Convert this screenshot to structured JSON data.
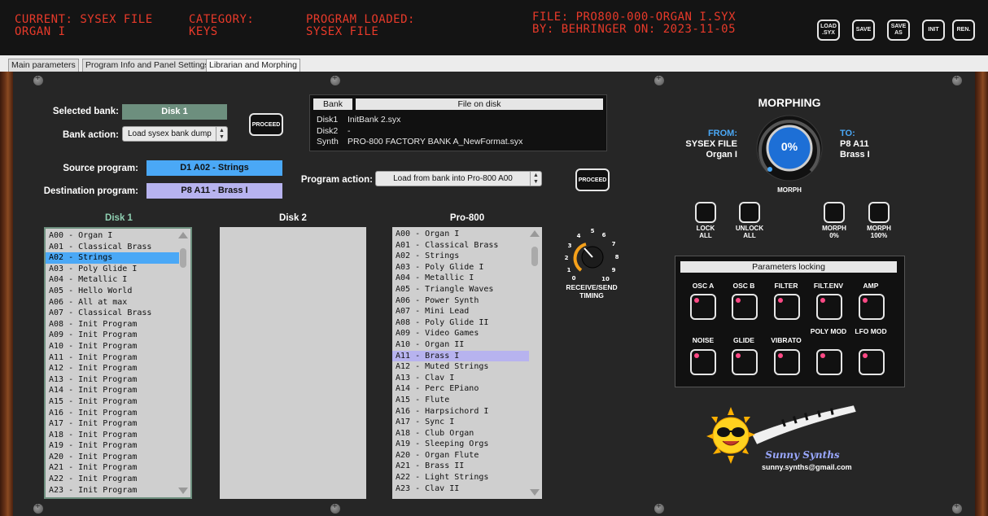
{
  "header": {
    "current_label": "CURRENT: SYSEX FILE",
    "current_value": "ORGAN I",
    "category_label": "CATEGORY:",
    "category_value": "KEYS",
    "loaded_label": "PROGRAM LOADED:",
    "loaded_value": "SYSEX FILE",
    "file_line": "FILE: PRO800-000-ORGAN I.SYX",
    "by_line": "BY: BEHRINGER ON: 2023-11-05",
    "buttons": [
      "LOAD .SYX",
      "SAVE",
      "SAVE AS",
      "INIT",
      "REN."
    ]
  },
  "tabs": [
    "Main parameters",
    "Program Info and Panel Settings",
    "Librarian and Morphing"
  ],
  "librarian": {
    "selected_bank_label": "Selected bank:",
    "selected_bank_value": "Disk 1",
    "bank_action_label": "Bank action:",
    "bank_action_value": "Load sysex bank dump",
    "proceed_label": "PROCEED",
    "source_label": "Source program:",
    "source_value": "D1 A02 - Strings",
    "dest_label": "Destination program:",
    "dest_value": "P8 A11 - Brass I",
    "program_action_label": "Program action:",
    "program_action_value": "Load from bank into Pro-800 A00",
    "file_table": {
      "col_bank": "Bank",
      "col_file": "File on disk",
      "rows": [
        {
          "bank": "Disk1",
          "file": "InitBank 2.syx"
        },
        {
          "bank": "Disk2",
          "file": "-"
        },
        {
          "bank": "Synth",
          "file": "PRO-800 FACTORY BANK A_NewFormat.syx"
        }
      ]
    },
    "disk1_title": "Disk 1",
    "disk2_title": "Disk 2",
    "pro800_title": "Pro-800",
    "disk1_items": [
      "A00 - Organ I",
      "A01 - Classical Brass",
      "A02 - Strings",
      "A03 - Poly Glide I",
      "A04 - Metallic I",
      "A05 - Hello World",
      "A06 - All at max",
      "A07 - Classical Brass",
      "A08 - Init Program",
      "A09 - Init Program",
      "A10 - Init Program",
      "A11 - Init Program",
      "A12 - Init Program",
      "A13 - Init Program",
      "A14 - Init Program",
      "A15 - Init Program",
      "A16 - Init Program",
      "A17 - Init Program",
      "A18 - Init Program",
      "A19 - Init Program",
      "A20 - Init Program",
      "A21 - Init Program",
      "A22 - Init Program",
      "A23 - Init Program"
    ],
    "pro800_items": [
      "A00 - Organ I",
      "A01 - Classical Brass",
      "A02 - Strings",
      "A03 - Poly Glide I",
      "A04 - Metallic I",
      "A05 - Triangle Waves",
      "A06 - Power Synth",
      "A07 - Mini Lead",
      "A08 - Poly Glide II",
      "A09 - Video Games",
      "A10 - Organ II",
      "A11 - Brass I",
      "A12 - Muted Strings",
      "A13 - Clav I",
      "A14 - Perc EPiano",
      "A15 - Flute",
      "A16 - Harpsichord I",
      "A17 - Sync I",
      "A18 - Club Organ",
      "A19 - Sleeping Orgs",
      "A20 - Organ Flute",
      "A21 - Brass II",
      "A22 - Light Strings",
      "A23 - Clav II"
    ],
    "timing_label": "RECEIVE/SEND",
    "timing_label2": "TIMING",
    "timing_scale": [
      "0",
      "1",
      "2",
      "3",
      "4",
      "5",
      "6",
      "7",
      "8",
      "9",
      "10"
    ],
    "timing_value": 3
  },
  "morphing": {
    "title": "MORPHING",
    "from_label": "FROM:",
    "from_line1": "SYSEX FILE",
    "from_line2": "Organ I",
    "to_label": "TO:",
    "to_line1": "P8 A11",
    "to_line2": "Brass I",
    "knob_value": "0%",
    "knob_label": "MORPH",
    "knob_level": 0,
    "buttons": [
      {
        "l1": "LOCK",
        "l2": "ALL"
      },
      {
        "l1": "UNLOCK",
        "l2": "ALL"
      },
      {
        "l1": "MORPH",
        "l2": "0%"
      },
      {
        "l1": "MORPH",
        "l2": "100%"
      }
    ],
    "params_title": "Parameters locking",
    "params_row1": [
      "OSC A",
      "OSC B",
      "FILTER",
      "FILT.ENV",
      "AMP"
    ],
    "params_row2": [
      "NOISE",
      "GLIDE",
      "VIBRATO",
      "POLY MOD",
      "LFO MOD"
    ]
  },
  "logo": {
    "brand": "Sunny Synths",
    "email": "sunny.synths@gmail.com"
  },
  "colors": {
    "lcd": "#e83a2a",
    "bank_box": "#6d8f7e",
    "source_box": "#4aa8f6",
    "dest_box": "#b7b3ef",
    "from_label": "#4aa8f6",
    "led": "#ff4a86"
  }
}
